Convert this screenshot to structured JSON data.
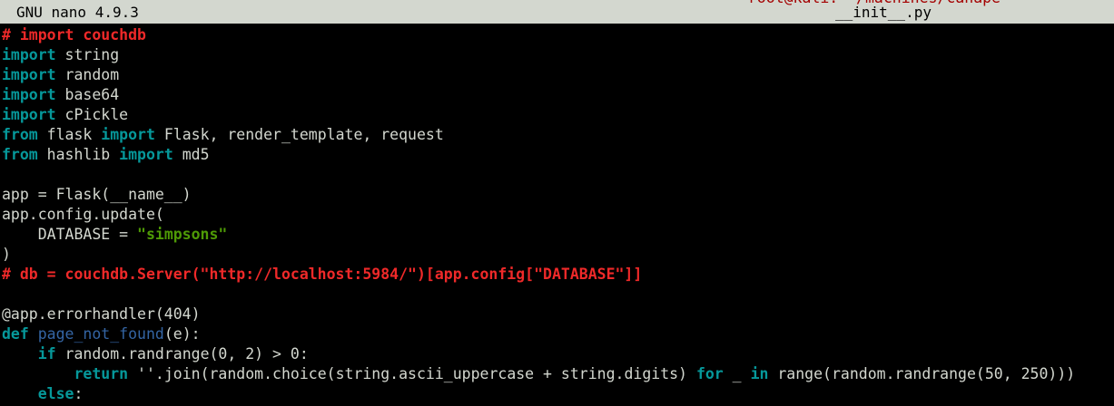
{
  "titlebar": {
    "app_name": "GNU nano 4.9.3",
    "file_name": "__init__.py",
    "cut_host_text": "root@kali: ~/machines/canape"
  },
  "colors": {
    "background": "#000000",
    "foreground": "#d3d7cf",
    "titlebar_bg": "#d3d7cf",
    "comment": "#ef2929",
    "keyword": "#06989a",
    "function_name": "#3465a4",
    "string": "#4e9a06"
  },
  "editor": {
    "lines": [
      [
        {
          "t": "# import couchdb",
          "c": "comment",
          "b": true
        }
      ],
      [
        {
          "t": "import",
          "c": "keyword",
          "b": true
        },
        {
          "t": " string",
          "c": "fg"
        }
      ],
      [
        {
          "t": "import",
          "c": "keyword",
          "b": true
        },
        {
          "t": " random",
          "c": "fg"
        }
      ],
      [
        {
          "t": "import",
          "c": "keyword",
          "b": true
        },
        {
          "t": " base64",
          "c": "fg"
        }
      ],
      [
        {
          "t": "import",
          "c": "keyword",
          "b": true
        },
        {
          "t": " cPickle",
          "c": "fg"
        }
      ],
      [
        {
          "t": "from",
          "c": "keyword",
          "b": true
        },
        {
          "t": " flask ",
          "c": "fg"
        },
        {
          "t": "import",
          "c": "keyword",
          "b": true
        },
        {
          "t": " Flask, render_template, request",
          "c": "fg"
        }
      ],
      [
        {
          "t": "from",
          "c": "keyword",
          "b": true
        },
        {
          "t": " hashlib ",
          "c": "fg"
        },
        {
          "t": "import",
          "c": "keyword",
          "b": true
        },
        {
          "t": " md5",
          "c": "fg"
        }
      ],
      [
        {
          "t": "",
          "c": "fg"
        }
      ],
      [
        {
          "t": "app = Flask(__name__)",
          "c": "fg"
        }
      ],
      [
        {
          "t": "app.config.update(",
          "c": "fg"
        }
      ],
      [
        {
          "t": "    DATABASE = ",
          "c": "fg"
        },
        {
          "t": "\"simpsons\"",
          "c": "string",
          "b": true
        }
      ],
      [
        {
          "t": ")",
          "c": "fg"
        }
      ],
      [
        {
          "t": "# db = couchdb.Server(\"http://localhost:5984/\")[app.config[\"DATABASE\"]]",
          "c": "comment",
          "b": true
        }
      ],
      [
        {
          "t": "",
          "c": "fg"
        }
      ],
      [
        {
          "t": "@app.errorhandler(404)",
          "c": "fg"
        }
      ],
      [
        {
          "t": "def",
          "c": "keyword",
          "b": true
        },
        {
          "t": " ",
          "c": "fg"
        },
        {
          "t": "page_not_found",
          "c": "function_name",
          "b": false
        },
        {
          "t": "(e):",
          "c": "fg"
        }
      ],
      [
        {
          "t": "    ",
          "c": "fg"
        },
        {
          "t": "if",
          "c": "keyword",
          "b": true
        },
        {
          "t": " random.randrange(0, 2) > 0:",
          "c": "fg"
        }
      ],
      [
        {
          "t": "        ",
          "c": "fg"
        },
        {
          "t": "return",
          "c": "keyword",
          "b": true
        },
        {
          "t": " ''.join(random.choice(string.ascii_uppercase + string.digits) ",
          "c": "fg"
        },
        {
          "t": "for",
          "c": "keyword",
          "b": true
        },
        {
          "t": " _ ",
          "c": "fg"
        },
        {
          "t": "in",
          "c": "keyword",
          "b": true
        },
        {
          "t": " range(random.randrange(50, 250)))",
          "c": "fg"
        }
      ],
      [
        {
          "t": "    ",
          "c": "fg"
        },
        {
          "t": "else",
          "c": "keyword",
          "b": true
        },
        {
          "t": ":",
          "c": "fg"
        }
      ]
    ]
  }
}
